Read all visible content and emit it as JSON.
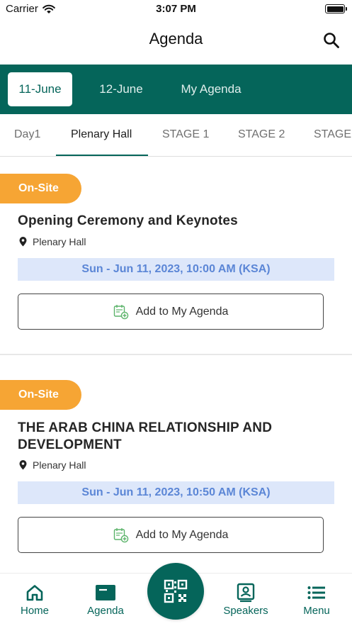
{
  "status_bar": {
    "carrier": "Carrier",
    "time": "3:07 PM"
  },
  "header": {
    "title": "Agenda"
  },
  "date_tabs": [
    {
      "label": "11-June",
      "active": true
    },
    {
      "label": "12-June",
      "active": false
    },
    {
      "label": "My Agenda",
      "active": false
    }
  ],
  "stage_tabs": [
    {
      "label": "Day1",
      "active": false
    },
    {
      "label": "Plenary Hall",
      "active": true
    },
    {
      "label": "STAGE 1",
      "active": false
    },
    {
      "label": "STAGE 2",
      "active": false
    },
    {
      "label": "STAGE",
      "active": false
    }
  ],
  "events": [
    {
      "badge": "On-Site",
      "title": "Opening Ceremony and Keynotes",
      "venue": "Plenary Hall",
      "datetime": "Sun - Jun 11, 2023, 10:00 AM (KSA)",
      "button_label": "Add to My Agenda"
    },
    {
      "badge": "On-Site",
      "title": "THE ARAB CHINA RELATIONSHIP AND DEVELOPMENT",
      "venue": "Plenary Hall",
      "datetime": "Sun - Jun 11, 2023, 10:50 AM (KSA)",
      "button_label": "Add to My Agenda"
    }
  ],
  "bottom_nav": [
    {
      "label": "Home",
      "icon": "home-icon"
    },
    {
      "label": "Agenda",
      "icon": "agenda-icon"
    },
    {
      "label": "",
      "icon": "qr-code-icon"
    },
    {
      "label": "Speakers",
      "icon": "speakers-icon"
    },
    {
      "label": "Menu",
      "icon": "menu-icon"
    }
  ],
  "colors": {
    "primary": "#05655a",
    "badge": "#f6a534",
    "date_strip_bg": "#dde7fa",
    "date_strip_text": "#5b86d6"
  }
}
